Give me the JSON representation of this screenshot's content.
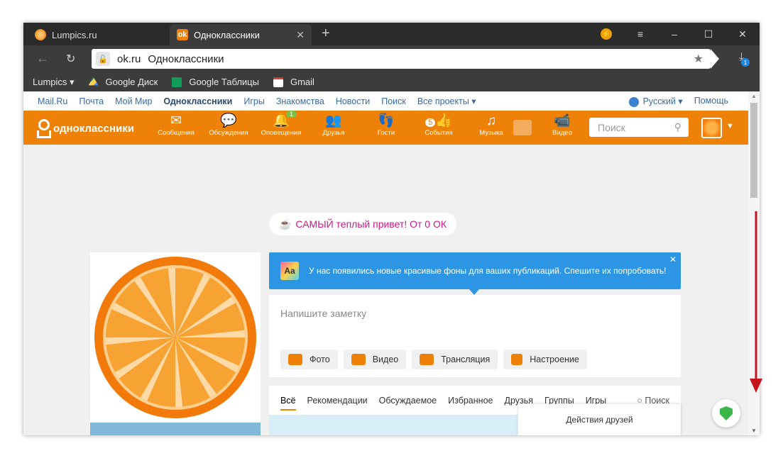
{
  "browser": {
    "tabs": [
      {
        "label": "Lumpics.ru"
      },
      {
        "label": "Одноклассники",
        "favicon_letter": "ok"
      }
    ],
    "new_tab_symbol": "+",
    "address": {
      "domain": "ok.ru",
      "title": "Одноклассники"
    },
    "download_count": "1",
    "bookmarks": [
      {
        "label": "Lumpics ▾"
      },
      {
        "label": "Google Диск"
      },
      {
        "label": "Google Таблицы"
      },
      {
        "label": "Gmail"
      }
    ]
  },
  "topnav": {
    "links": [
      "Mail.Ru",
      "Почта",
      "Мой Мир",
      "Одноклассники",
      "Игры",
      "Знакомства",
      "Новости",
      "Поиск",
      "Все проекты ▾"
    ],
    "language": "Русский ▾",
    "help": "Помощь"
  },
  "okbar": {
    "logo": "одноклассники",
    "items": [
      {
        "label": "Сообщения",
        "icon": "envelope-icon"
      },
      {
        "label": "Обсуждения",
        "icon": "chat-bubbles-icon"
      },
      {
        "label": "Оповещения",
        "icon": "bell-icon",
        "badge": "1"
      },
      {
        "label": "Друзья",
        "icon": "friends-icon"
      },
      {
        "label": "Гости",
        "icon": "footprints-icon"
      },
      {
        "label": "События",
        "icon": "events-icon",
        "badge_inline": "5"
      },
      {
        "label": "Музыка",
        "icon": "music-note-icon"
      },
      {
        "label": "Видео",
        "icon": "video-camera-icon"
      }
    ],
    "search_placeholder": "Поиск",
    "accent": "#ee8208"
  },
  "content": {
    "greeting": "САМЫЙ теплый привет! От 0 ОК",
    "banner": {
      "icon_text": "Aa",
      "text": "У нас появились новые красивые фоны для ваших публикаций. Спешите их попробовать!"
    },
    "composer": {
      "placeholder": "Напишите заметку",
      "actions": [
        "Фото",
        "Видео",
        "Трансляция",
        "Настроение"
      ]
    },
    "feed_tabs": [
      "Всё",
      "Рекомендации",
      "Обсуждаемое",
      "Избранное",
      "Друзья",
      "Группы",
      "Игры"
    ],
    "feed_search": "Поиск",
    "friends_activity": "Действия друзей"
  }
}
